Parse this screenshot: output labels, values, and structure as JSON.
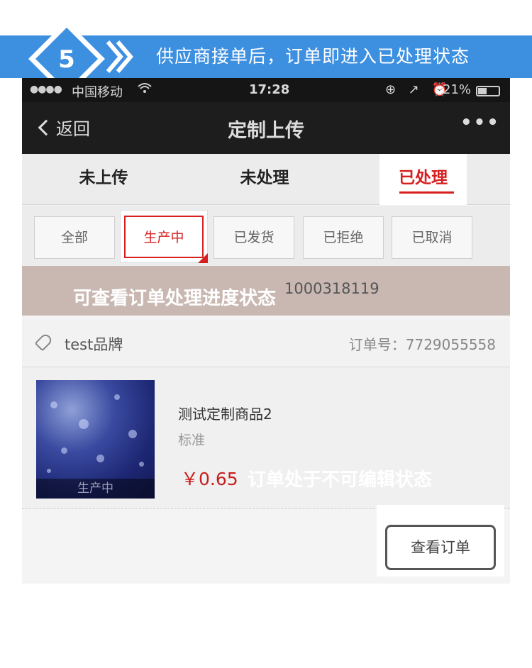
{
  "banner": {
    "step_number": "5",
    "text": "供应商接单后，订单即进入已处理状态",
    "bg_color": "#3d8fe0"
  },
  "statusbar": {
    "signal_dots": "●●●●",
    "carrier": "中国移动",
    "wifi_icon": "wifi-icon",
    "time": "17:28",
    "system_icons": "⊕ ↗ ⏰",
    "battery_pct": "21%"
  },
  "navbar": {
    "back_label": "返回",
    "title": "定制上传",
    "more_label": "•••"
  },
  "tabs": [
    {
      "label": "未上传"
    },
    {
      "label": "未处理"
    },
    {
      "label": "已处理",
      "active": true
    }
  ],
  "filters": [
    {
      "label": "全部"
    },
    {
      "label": "生产中",
      "active": true
    },
    {
      "label": "已发货"
    },
    {
      "label": "已拒绝"
    },
    {
      "label": "已取消"
    }
  ],
  "notice": {
    "partial_text": "1000318119",
    "overlay_annotation": "可查看订单处理进度状态"
  },
  "order": {
    "brand": "test品牌",
    "order_number": "订单号：7729055558",
    "product_name": "测试定制商品2",
    "spec": "标准",
    "price": "￥0.65",
    "thumb_status": "生产中",
    "edit_annotation": "订单处于不可编辑状态",
    "view_button": "查看订单"
  },
  "colors": {
    "accent_red": "#d62020",
    "price_red": "#c81e1e"
  }
}
